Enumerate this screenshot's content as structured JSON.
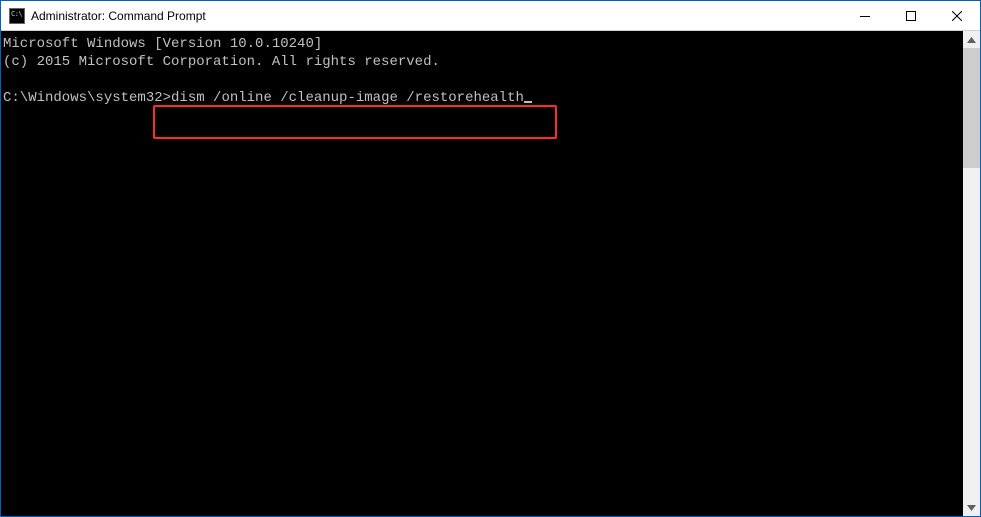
{
  "window": {
    "title": "Administrator: Command Prompt"
  },
  "console": {
    "line1": "Microsoft Windows [Version 10.0.10240]",
    "line2": "(c) 2015 Microsoft Corporation. All rights reserved.",
    "blank": "",
    "prompt": "C:\\Windows\\system32>",
    "command": "dism /online /cleanup-image /restorehealth"
  }
}
